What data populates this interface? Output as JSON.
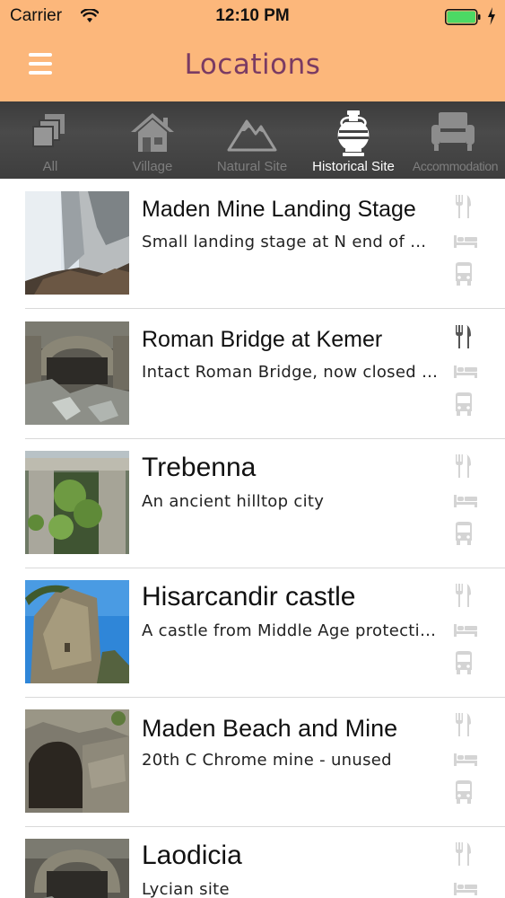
{
  "status_bar": {
    "carrier": "Carrier",
    "time": "12:10 PM"
  },
  "nav": {
    "title": "Locations",
    "menu_icon": "hamburger-menu-icon"
  },
  "tabs": [
    {
      "label": "All",
      "icon": "stack-icon",
      "active": false
    },
    {
      "label": "Village",
      "icon": "house-icon",
      "active": false
    },
    {
      "label": "Natural Site",
      "icon": "mountain-icon",
      "active": false
    },
    {
      "label": "Historical Site",
      "icon": "amphora-icon",
      "active": true
    },
    {
      "label": "Accommodation",
      "icon": "armchair-icon",
      "active": false
    }
  ],
  "locations": [
    {
      "name": "Maden Mine Landing Stage",
      "description": "Small landing stage at N end of Maden Beach",
      "restaurant": false
    },
    {
      "name": "Roman Bridge at Kemer",
      "description": "Intact Roman Bridge, now closed to traffic",
      "restaurant": true
    },
    {
      "name": "Trebenna",
      "description": "An ancient hilltop city",
      "restaurant": false
    },
    {
      "name": "Hisarcandir castle",
      "description": "A castle from Middle Age protecting the valley",
      "restaurant": false
    },
    {
      "name": "Maden Beach and Mine",
      "description": "20th C Chrome mine - unused",
      "restaurant": false
    },
    {
      "name": "Laodicia",
      "description": "Lycian site",
      "restaurant": false
    }
  ],
  "amenity_icons": [
    "restaurant-icon",
    "bed-icon",
    "bus-icon"
  ],
  "colors": {
    "header": "#fcb77b",
    "title": "#7a3b63",
    "tabbar": "#444444",
    "amenity_inactive": "#d4d4d4",
    "amenity_active": "#555555"
  }
}
